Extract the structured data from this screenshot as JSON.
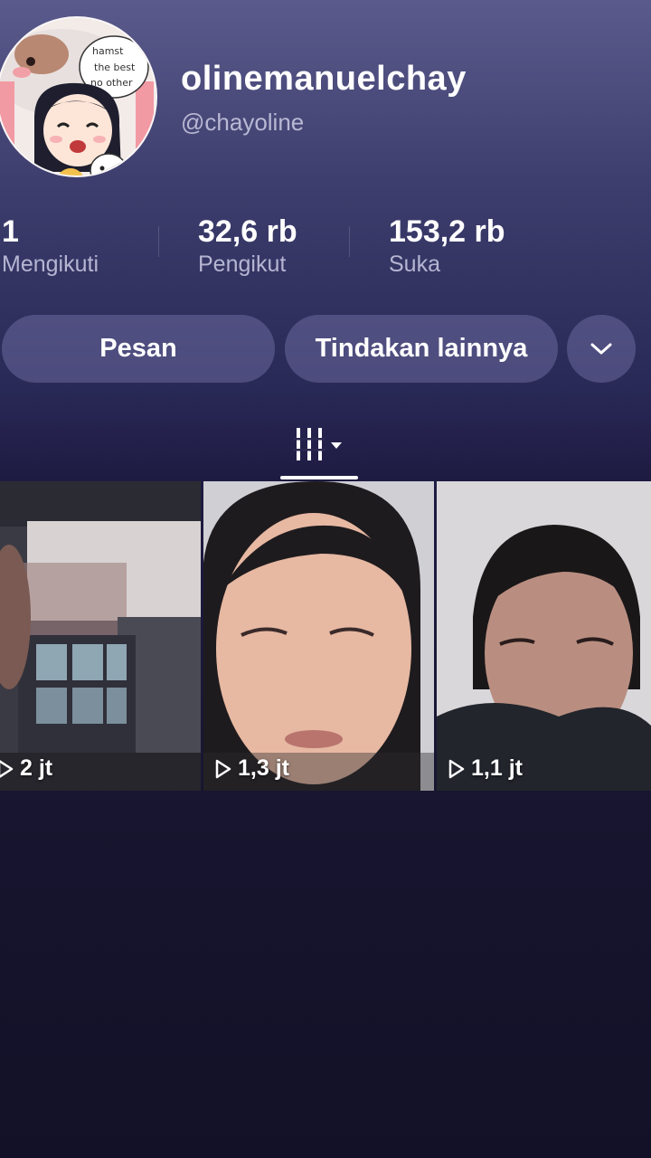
{
  "profile": {
    "display_name": "olinemanuelchay",
    "username": "@chayoline",
    "avatar_caption": [
      "hamst",
      "the best",
      "no other"
    ]
  },
  "stats": [
    {
      "value": "1",
      "label": "Mengikuti"
    },
    {
      "value": "32,6 rb",
      "label": "Pengikut"
    },
    {
      "value": "153,2 rb",
      "label": "Suka"
    }
  ],
  "actions": {
    "message_label": "Pesan",
    "more_actions_label": "Tindakan lainnya",
    "dropdown_icon": "chevron-down-icon"
  },
  "tabs": {
    "active_icon": "grid-icon"
  },
  "videos": [
    {
      "views": "2 jt"
    },
    {
      "views": "1,3 jt"
    },
    {
      "views": "1,1 jt"
    }
  ],
  "colors": {
    "background_top": "#5a5a8c",
    "background_bottom": "#131127",
    "button_bg": "#5b5a8e",
    "secondary_text": "#b6b5d2"
  }
}
